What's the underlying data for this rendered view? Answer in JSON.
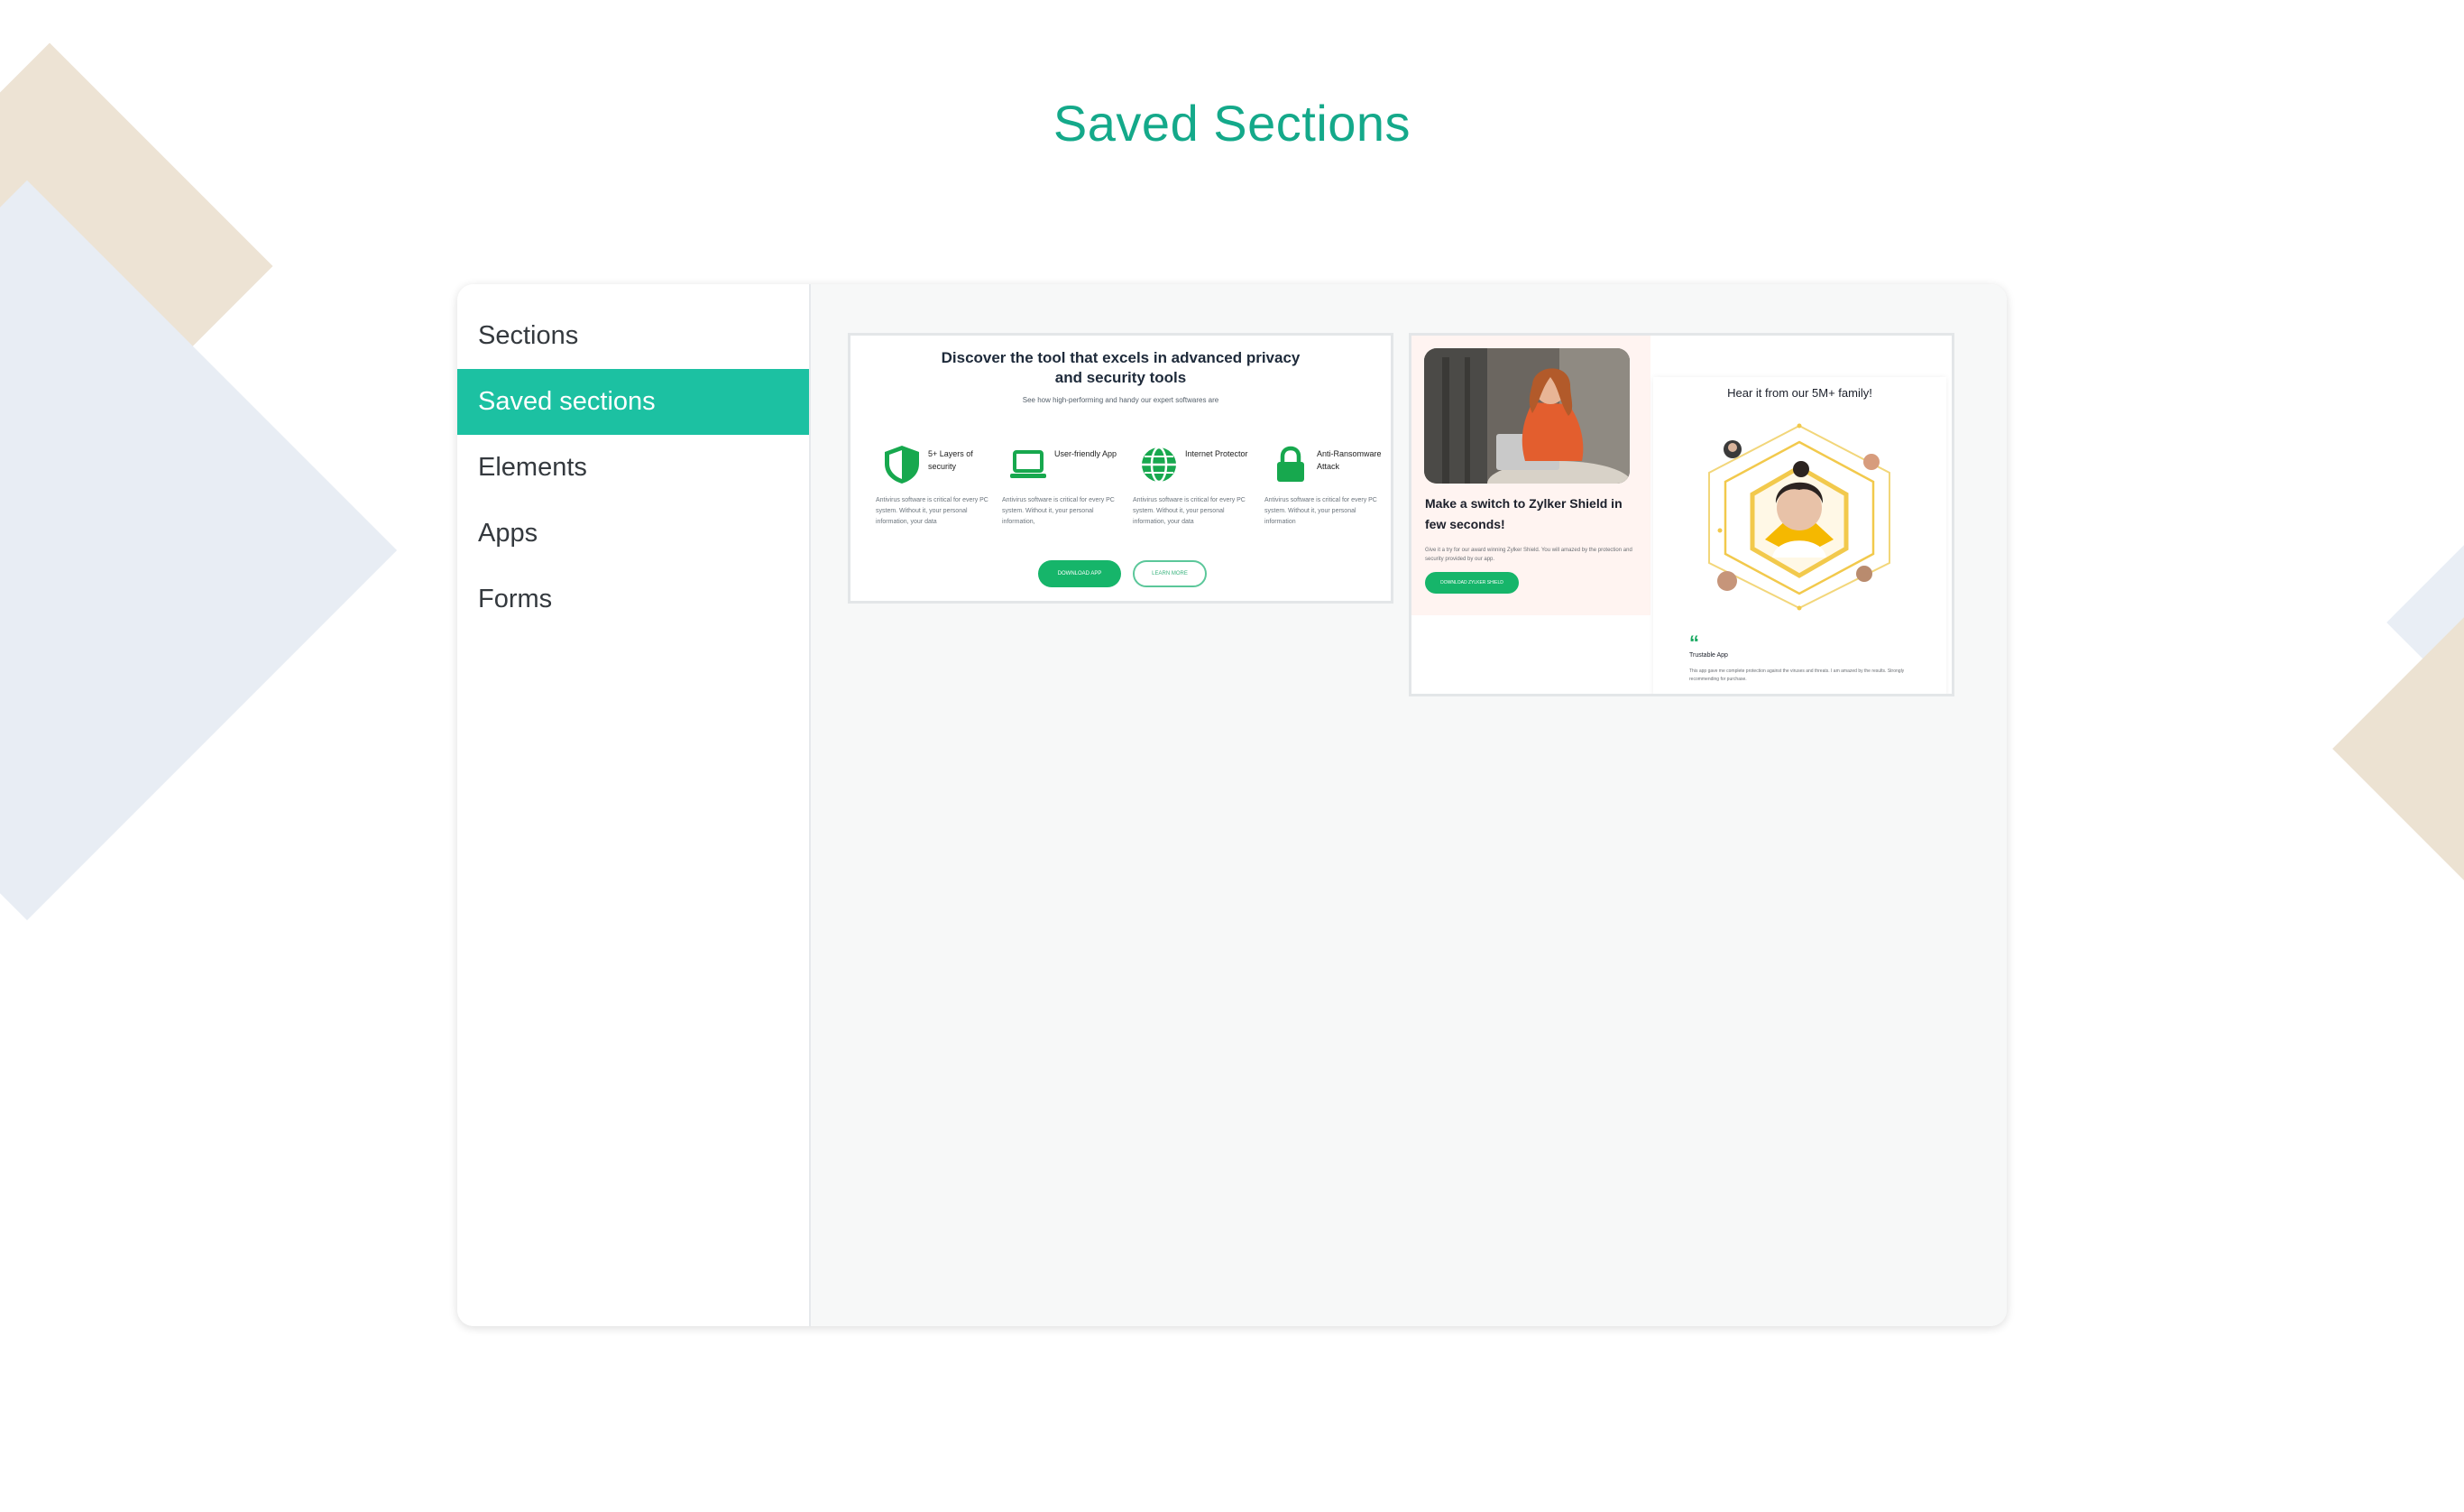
{
  "page": {
    "title": "Saved Sections"
  },
  "sidebar": {
    "items": [
      {
        "label": "Sections",
        "active": false
      },
      {
        "label": "Saved sections",
        "active": true
      },
      {
        "label": "Elements",
        "active": false
      },
      {
        "label": "Apps",
        "active": false
      },
      {
        "label": "Forms",
        "active": false
      }
    ]
  },
  "cards": {
    "features": {
      "title": "Discover the tool that excels in advanced privacy and security tools",
      "subtitle": "See how high-performing and handy our expert softwares are",
      "items": [
        {
          "label": "5+ Layers of security",
          "desc": "Antivirus software is critical for every PC system. Without it, your personal information, your data",
          "icon": "shield-icon"
        },
        {
          "label": "User-friendly App",
          "desc": "Antivirus software is critical for every PC system. Without it, your personal information,",
          "icon": "laptop-icon"
        },
        {
          "label": "Internet Protector",
          "desc": "Antivirus software is critical for every PC system. Without it, your personal information, your data",
          "icon": "globe-icon"
        },
        {
          "label": "Anti-Ransomware Attack",
          "desc": "Antivirus software is critical for every PC system. Without it, your personal information",
          "icon": "lock-icon"
        }
      ],
      "primary_button": "DOWNLOAD APP",
      "secondary_button": "LEARN MORE"
    },
    "testimonial": {
      "heading": "Make a switch to Zylker Shield in few seconds!",
      "desc": "Give it a try for our award winning Zylker Shield. You will amazed by the protection and security provided by our app.",
      "button": "DOWNLOAD ZYLKER SHIELD",
      "right_title": "Hear it from our 5M+ family!",
      "review_title": "Trustable App",
      "review_text": "This app gave me complete protection against the viruses and threats. I am amazed by the results. Strongly recommending for purchase."
    }
  },
  "colors": {
    "accent": "#1cc1a2",
    "title": "#14a98a",
    "green_button": "#16b56a",
    "icon_green": "#17a84e",
    "hex_yellow": "#f2c94c"
  }
}
